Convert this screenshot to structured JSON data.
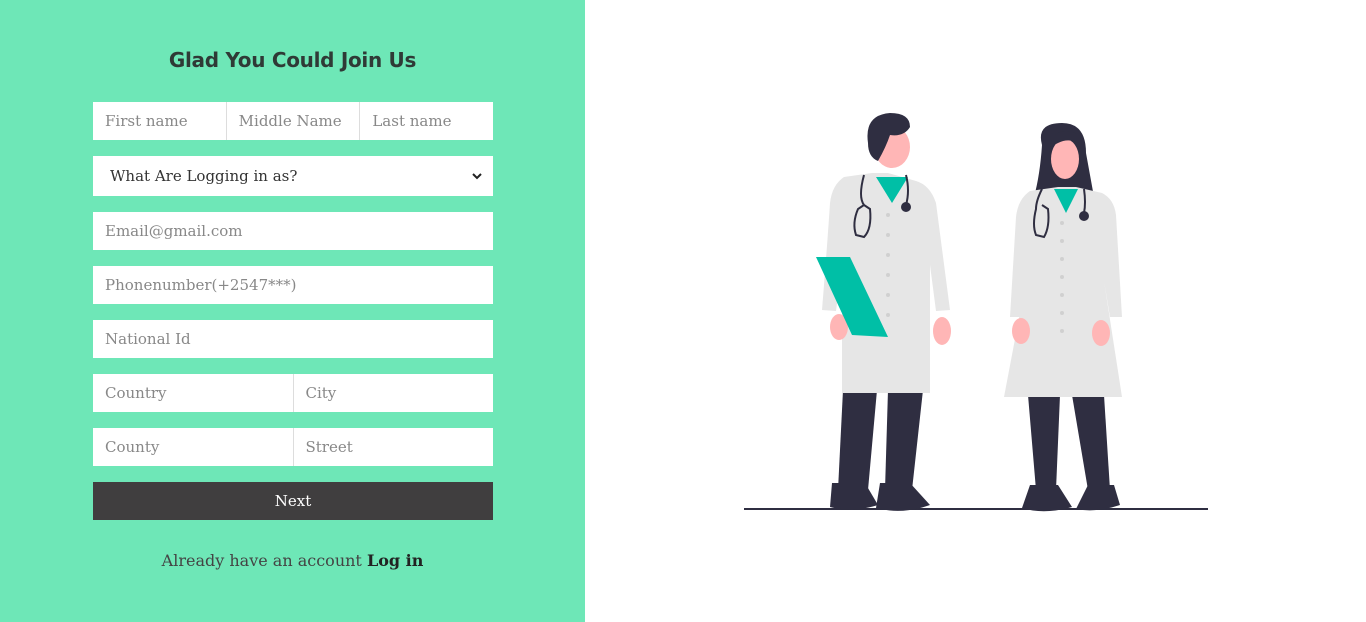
{
  "form": {
    "title": "Glad You Could Join Us",
    "first_name_placeholder": "First name",
    "middle_name_placeholder": "Middle Name",
    "last_name_placeholder": "Last name",
    "role_select_value": "What Are Logging in as?",
    "email_placeholder": "Email@gmail.com",
    "phone_placeholder": "Phonenumber(+2547***)",
    "national_id_placeholder": "National Id",
    "country_placeholder": "Country",
    "city_placeholder": "City",
    "county_placeholder": "County",
    "street_placeholder": "Street",
    "next_label": "Next",
    "login_prompt": "Already have an account",
    "login_link": "Log in"
  },
  "colors": {
    "panel_bg": "#6ee7b7",
    "button_bg": "#403e3f",
    "accent": "#00bfa6",
    "dark": "#2f2e41"
  },
  "illustration": {
    "icon": "two-doctors-illustration"
  }
}
